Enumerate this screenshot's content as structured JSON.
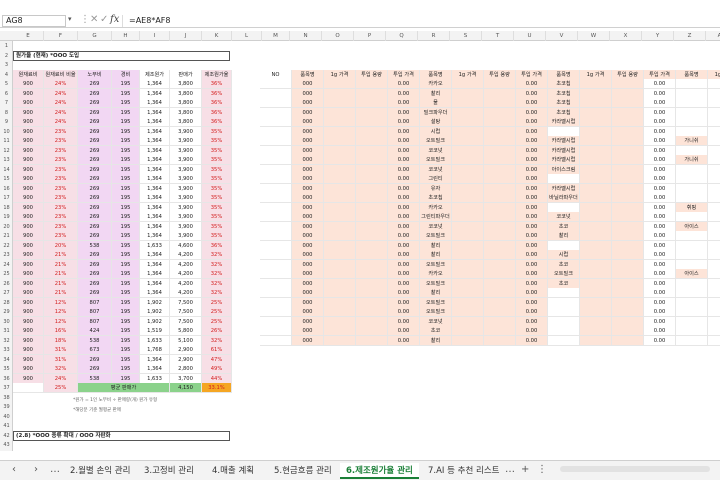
{
  "formula_bar": {
    "name_box": "AG8",
    "formula": "=AE8*AF8",
    "fx_label": "fx",
    "cancel_icon": "x-icon",
    "confirm_icon": "check-icon"
  },
  "column_letters": [
    "E",
    "F",
    "G",
    "H",
    "I",
    "J",
    "K",
    "L",
    "M",
    "N",
    "O",
    "P",
    "Q",
    "R",
    "S",
    "T",
    "U",
    "V",
    "W",
    "X",
    "Y",
    "Z",
    "AA"
  ],
  "row_numbers": [
    "1",
    "2",
    "3",
    "4",
    "5",
    "6",
    "7",
    "8",
    "9",
    "10",
    "11",
    "12",
    "13",
    "14",
    "15",
    "16",
    "17",
    "18",
    "19",
    "20",
    "21",
    "22",
    "23",
    "24",
    "25",
    "26",
    "27",
    "28",
    "29",
    "30",
    "31",
    "32",
    "33",
    "34",
    "35",
    "36",
    "37",
    "38",
    "39",
    "40",
    "41",
    "42",
    "43"
  ],
  "left_section": {
    "title": "원가율 (현재) *OOO 도입",
    "headers": [
      "원재료비",
      "원재료비 비율",
      "노무비",
      "경비",
      "제조원가",
      "판매가",
      "제조원가율"
    ],
    "rows": [
      [
        "900",
        "24%",
        "269",
        "195",
        "1,364",
        "3,800",
        "36%"
      ],
      [
        "900",
        "24%",
        "269",
        "195",
        "1,364",
        "3,800",
        "36%"
      ],
      [
        "900",
        "24%",
        "269",
        "195",
        "1,364",
        "3,800",
        "36%"
      ],
      [
        "900",
        "24%",
        "269",
        "195",
        "1,364",
        "3,800",
        "36%"
      ],
      [
        "900",
        "24%",
        "269",
        "195",
        "1,364",
        "3,800",
        "36%"
      ],
      [
        "900",
        "23%",
        "269",
        "195",
        "1,364",
        "3,900",
        "35%"
      ],
      [
        "900",
        "23%",
        "269",
        "195",
        "1,364",
        "3,900",
        "35%"
      ],
      [
        "900",
        "23%",
        "269",
        "195",
        "1,364",
        "3,900",
        "35%"
      ],
      [
        "900",
        "23%",
        "269",
        "195",
        "1,364",
        "3,900",
        "35%"
      ],
      [
        "900",
        "23%",
        "269",
        "195",
        "1,364",
        "3,900",
        "35%"
      ],
      [
        "900",
        "23%",
        "269",
        "195",
        "1,364",
        "3,900",
        "35%"
      ],
      [
        "900",
        "23%",
        "269",
        "195",
        "1,364",
        "3,900",
        "35%"
      ],
      [
        "900",
        "23%",
        "269",
        "195",
        "1,364",
        "3,900",
        "35%"
      ],
      [
        "900",
        "23%",
        "269",
        "195",
        "1,364",
        "3,900",
        "35%"
      ],
      [
        "900",
        "23%",
        "269",
        "195",
        "1,364",
        "3,900",
        "35%"
      ],
      [
        "900",
        "23%",
        "269",
        "195",
        "1,364",
        "3,900",
        "35%"
      ],
      [
        "900",
        "23%",
        "269",
        "195",
        "1,364",
        "3,900",
        "35%"
      ],
      [
        "900",
        "20%",
        "538",
        "195",
        "1,633",
        "4,600",
        "36%"
      ],
      [
        "900",
        "21%",
        "269",
        "195",
        "1,364",
        "4,200",
        "32%"
      ],
      [
        "900",
        "21%",
        "269",
        "195",
        "1,364",
        "4,200",
        "32%"
      ],
      [
        "900",
        "21%",
        "269",
        "195",
        "1,364",
        "4,200",
        "32%"
      ],
      [
        "900",
        "21%",
        "269",
        "195",
        "1,364",
        "4,200",
        "32%"
      ],
      [
        "900",
        "21%",
        "269",
        "195",
        "1,364",
        "4,200",
        "32%"
      ],
      [
        "900",
        "12%",
        "807",
        "195",
        "1,902",
        "7,500",
        "25%"
      ],
      [
        "900",
        "12%",
        "807",
        "195",
        "1,902",
        "7,500",
        "25%"
      ],
      [
        "900",
        "12%",
        "807",
        "195",
        "1,902",
        "7,500",
        "25%"
      ],
      [
        "900",
        "16%",
        "424",
        "195",
        "1,519",
        "5,800",
        "26%"
      ],
      [
        "900",
        "18%",
        "538",
        "195",
        "1,633",
        "5,100",
        "32%"
      ],
      [
        "900",
        "31%",
        "673",
        "195",
        "1,768",
        "2,900",
        "61%"
      ],
      [
        "900",
        "31%",
        "269",
        "195",
        "1,364",
        "2,900",
        "47%"
      ],
      [
        "900",
        "32%",
        "269",
        "195",
        "1,364",
        "2,800",
        "49%"
      ],
      [
        "900",
        "24%",
        "538",
        "195",
        "1,633",
        "3,700",
        "44%"
      ]
    ],
    "summary_label": "평균 판매가",
    "summary_price": "4,150",
    "summary_rate": "33.1%",
    "summary_left": "25%",
    "note1": "*원가 = 1인 노무비 ÷ 판매량(개) 원가 유형",
    "note2": "*해당분 기준 월평균 판매",
    "section2_title": "(2.8) *OOO 종류 확대 / OOO 자판화"
  },
  "right_section": {
    "headers": [
      "NO",
      "품목명",
      "1g 가격",
      "투입 용량",
      "투입 가격",
      "품목명",
      "1g 가격",
      "투입 용량",
      "투입 가격",
      "품목명",
      "1g 가격",
      "투입 용량",
      "투입 가격",
      "품목명",
      "1g 가격"
    ],
    "col_a": [
      "000",
      "000",
      "000",
      "000",
      "000",
      "000",
      "000",
      "000",
      "000",
      "000",
      "000",
      "000",
      "000",
      "000",
      "000",
      "000",
      "000",
      "000",
      "000",
      "000",
      "000",
      "000",
      "000",
      "000",
      "000",
      "000",
      "000",
      "000"
    ],
    "col_b": [
      "0.00",
      "0.00",
      "0.00",
      "0.00",
      "0.00",
      "0.00",
      "0.00",
      "0.00",
      "0.00",
      "0.00",
      "0.00",
      "0.00",
      "0.00",
      "0.00",
      "0.00",
      "0.00",
      "0.00",
      "0.00",
      "0.00",
      "0.00",
      "0.00",
      "0.00",
      "0.00",
      "0.00",
      "0.00",
      "0.00",
      "0.00",
      "0.00"
    ],
    "names_1": [
      "카카오",
      "찰리",
      "물",
      "밀크파우더",
      "설탕",
      "시럽",
      "오트밀크",
      "코코넛",
      "오트밀크",
      "코코넛",
      "그린티",
      "유자",
      "초코칩",
      "카카오",
      "그린티파우더",
      "코코넛",
      "오트밀크",
      "찰리",
      "찰리",
      "오트밀크",
      "카카오",
      "오트밀크",
      "찰리",
      "오트밀크",
      "오트밀크",
      "코코넛",
      "초코",
      "찰리"
    ],
    "names_2": [
      "초코칩",
      "초코칩",
      "초코칩",
      "초코칩",
      "카라멜시럽",
      "",
      "카라멜시럽",
      "카라멜시럽",
      "카라멜시럽",
      "아이스크림",
      "",
      "카라멜시럽",
      "바닐라파우더",
      "",
      "코코넛",
      "초코",
      "찰리",
      "",
      "시럽",
      "초코",
      "오트밀크",
      "초코",
      "",
      "",
      "",
      "",
      "",
      ""
    ],
    "names_3": [
      "",
      "",
      "",
      "",
      "",
      "",
      "가니쉬",
      "",
      "가니쉬",
      "",
      "",
      "",
      "",
      "휘핑",
      "",
      "아이스",
      "",
      "",
      "",
      "",
      "아이스",
      "",
      "",
      "",
      "",
      "",
      "",
      ""
    ]
  },
  "tabs": [
    {
      "label": "2.월별 손익 관리",
      "active": false
    },
    {
      "label": "3.고정비 관리",
      "active": false
    },
    {
      "label": "4.매출 계획",
      "active": false
    },
    {
      "label": "5.현금흐름 관리",
      "active": false
    },
    {
      "label": "6.제조원가율 관리",
      "active": true
    },
    {
      "label": "7.AI 등 추천 리스트",
      "active": false
    }
  ],
  "tab_nav": {
    "prev": "‹",
    "next": "›",
    "more": "…",
    "add": "+",
    "overflow": "⋮"
  },
  "colors": {
    "accent_green": "#1a7f37",
    "pink": "#f7dfe6",
    "lavender": "#f2d7f3",
    "peach": "#fde4d8",
    "red_text": "#d32020",
    "summary_green": "#8bd28b",
    "summary_orange": "#f5a623"
  }
}
